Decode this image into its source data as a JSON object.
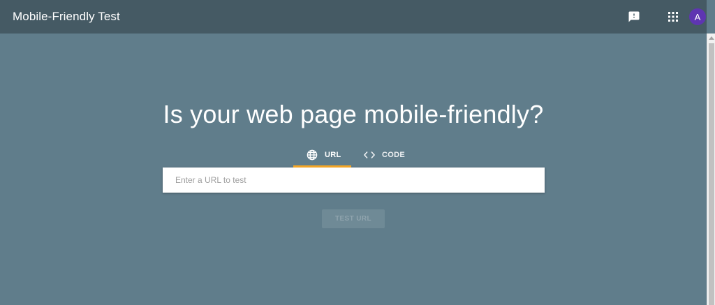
{
  "header": {
    "title": "Mobile-Friendly Test",
    "feedback_icon": "feedback-icon",
    "apps_icon": "apps-grid-icon",
    "avatar_initial": "A"
  },
  "main": {
    "headline": "Is your web page mobile-friendly?",
    "tabs": [
      {
        "label": "URL",
        "icon": "globe-icon",
        "selected": true
      },
      {
        "label": "CODE",
        "icon": "code-brackets-icon",
        "selected": false
      }
    ],
    "url_input": {
      "placeholder": "Enter a URL to test",
      "value": ""
    },
    "test_button": {
      "label": "TEST URL",
      "enabled": false
    }
  },
  "colors": {
    "background": "#607d8b",
    "header": "#455a64",
    "tab_indicator": "#f9a825",
    "avatar": "#5e35b1"
  }
}
